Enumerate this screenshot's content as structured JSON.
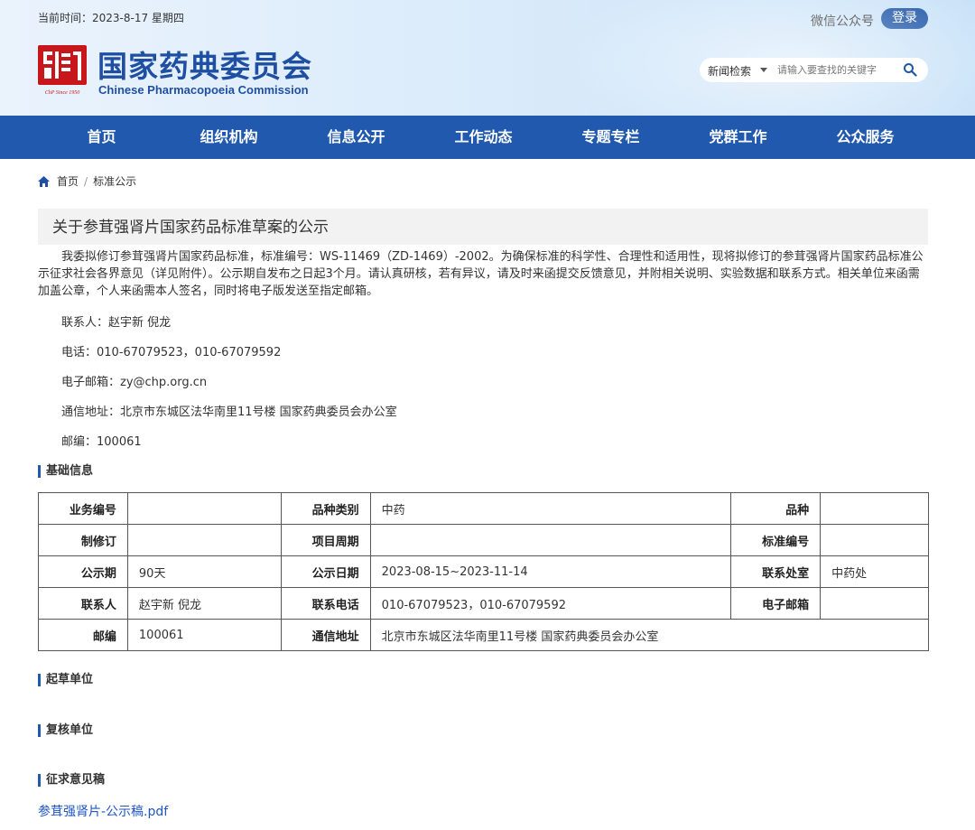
{
  "header": {
    "current_time": "当前时间：2023-8-17 星期四",
    "wechat": "微信公众号",
    "login": "登录",
    "logo_cn": "国家药典委员会",
    "logo_en": "Chinese Pharmacopoeia Commission",
    "seal_text": "ChP Since 1950",
    "search": {
      "select_value": "新闻检索",
      "placeholder": "请输入要查找的关键字"
    }
  },
  "nav": [
    "首页",
    "组织机构",
    "信息公开",
    "工作动态",
    "专题专栏",
    "党群工作",
    "公众服务"
  ],
  "breadcrumb": {
    "home": "首页",
    "sep": "/",
    "current": "标准公示"
  },
  "article": {
    "title": "关于参茸强肾片国家药品标准草案的公示",
    "intro": "我委拟修订参茸强肾片国家药品标准，标准编号：WS-11469（ZD-1469）-2002。为确保标准的科学性、合理性和适用性，现将拟修订的参茸强肾片国家药品标准公示征求社会各界意见（详见附件）。公示期自发布之日起3个月。请认真研核，若有异议，请及时来函提交反馈意见，并附相关说明、实验数据和联系方式。相关单位来函需加盖公章，个人来函需本人签名，同时将电子版发送至指定邮箱。",
    "contact": "联系人：赵宇新 倪龙",
    "phone": "电话：010-67079523，010-67079592",
    "email": "电子邮箱：zy@chp.org.cn",
    "address": "通信地址：北京市东城区法华南里11号楼 国家药典委员会办公室",
    "postcode": "邮编：100061"
  },
  "sections": {
    "basic_info": "基础信息",
    "drafting_unit": "起草单位",
    "review_unit": "复核单位",
    "draft_doc": "征求意见稿"
  },
  "table": {
    "rows": [
      [
        {
          "label": "业务编号",
          "value": ""
        },
        {
          "label": "品种类别",
          "value": "中药"
        },
        {
          "label": "品种",
          "value": ""
        }
      ],
      [
        {
          "label": "制修订",
          "value": ""
        },
        {
          "label": "项目周期",
          "value": ""
        },
        {
          "label": "标准编号",
          "value": ""
        }
      ],
      [
        {
          "label": "公示期",
          "value": "90天"
        },
        {
          "label": "公示日期",
          "value": "2023-08-15~2023-11-14"
        },
        {
          "label": "联系处室",
          "value": "中药处"
        }
      ],
      [
        {
          "label": "联系人",
          "value": "赵宇新 倪龙"
        },
        {
          "label": "联系电话",
          "value": "010-67079523，010-67079592"
        },
        {
          "label": "电子邮箱",
          "value": ""
        }
      ],
      [
        {
          "label": "邮编",
          "value": "100061"
        },
        {
          "label": "通信地址",
          "value": "北京市东城区法华南里11号楼 国家药典委员会办公室"
        }
      ]
    ]
  },
  "attachment": "参茸强肾片-公示稿.pdf",
  "colors": {
    "brand_blue": "#2059ad",
    "seal_red": "#c8161d",
    "link": "#1f56c4"
  }
}
